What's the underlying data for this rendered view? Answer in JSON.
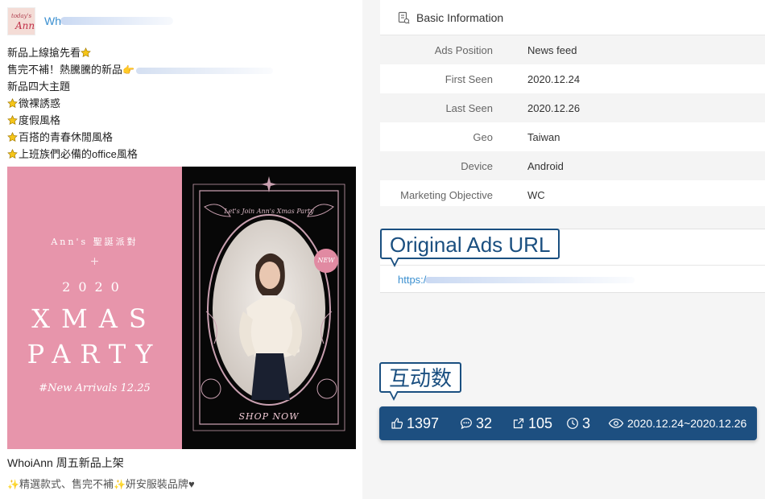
{
  "post": {
    "page_name": "Wh",
    "lines": [
      "新品上線搶先看",
      "售完不補！熱騰騰的新品",
      "新品四大主題",
      "微裸誘惑",
      "度假風格",
      "百搭的青春休閒風格",
      "上班族們必備的office風格"
    ],
    "image": {
      "subtitle": "Ann's 聖誕派對",
      "plus": "+",
      "year": "2020",
      "title_line1": "XMAS",
      "title_line2": "PARTY",
      "tagline": "#New Arrivals 12.25",
      "frame_text": "Let's Join Ann's Xmas Party",
      "badge": "NEW",
      "shop": "SHOP NOW"
    },
    "caption_title": "WhoiAnn 周五新品上架",
    "caption_body": "精選款式、售完不補",
    "caption_body2": "妍安服裝品牌"
  },
  "info": {
    "title": "Basic Information",
    "rows": [
      {
        "label": "Ads Position",
        "value": "News feed"
      },
      {
        "label": "First Seen",
        "value": "2020.12.24"
      },
      {
        "label": "Last Seen",
        "value": "2020.12.26"
      },
      {
        "label": "Geo",
        "value": "Taiwan"
      },
      {
        "label": "Device",
        "value": "Android"
      },
      {
        "label": "Marketing Objective",
        "value": "WC"
      }
    ]
  },
  "url": {
    "callout": "Original Ads URL",
    "prefix": "https:/"
  },
  "interactions": {
    "callout": "互动数",
    "likes": "1397",
    "comments": "32",
    "shares": "105",
    "duration": "3",
    "date_range": "2020.12.24~2020.12.26"
  },
  "colors": {
    "accent": "#1d4f80",
    "link": "#3a8fd0",
    "ad_pink": "#e795ab"
  }
}
